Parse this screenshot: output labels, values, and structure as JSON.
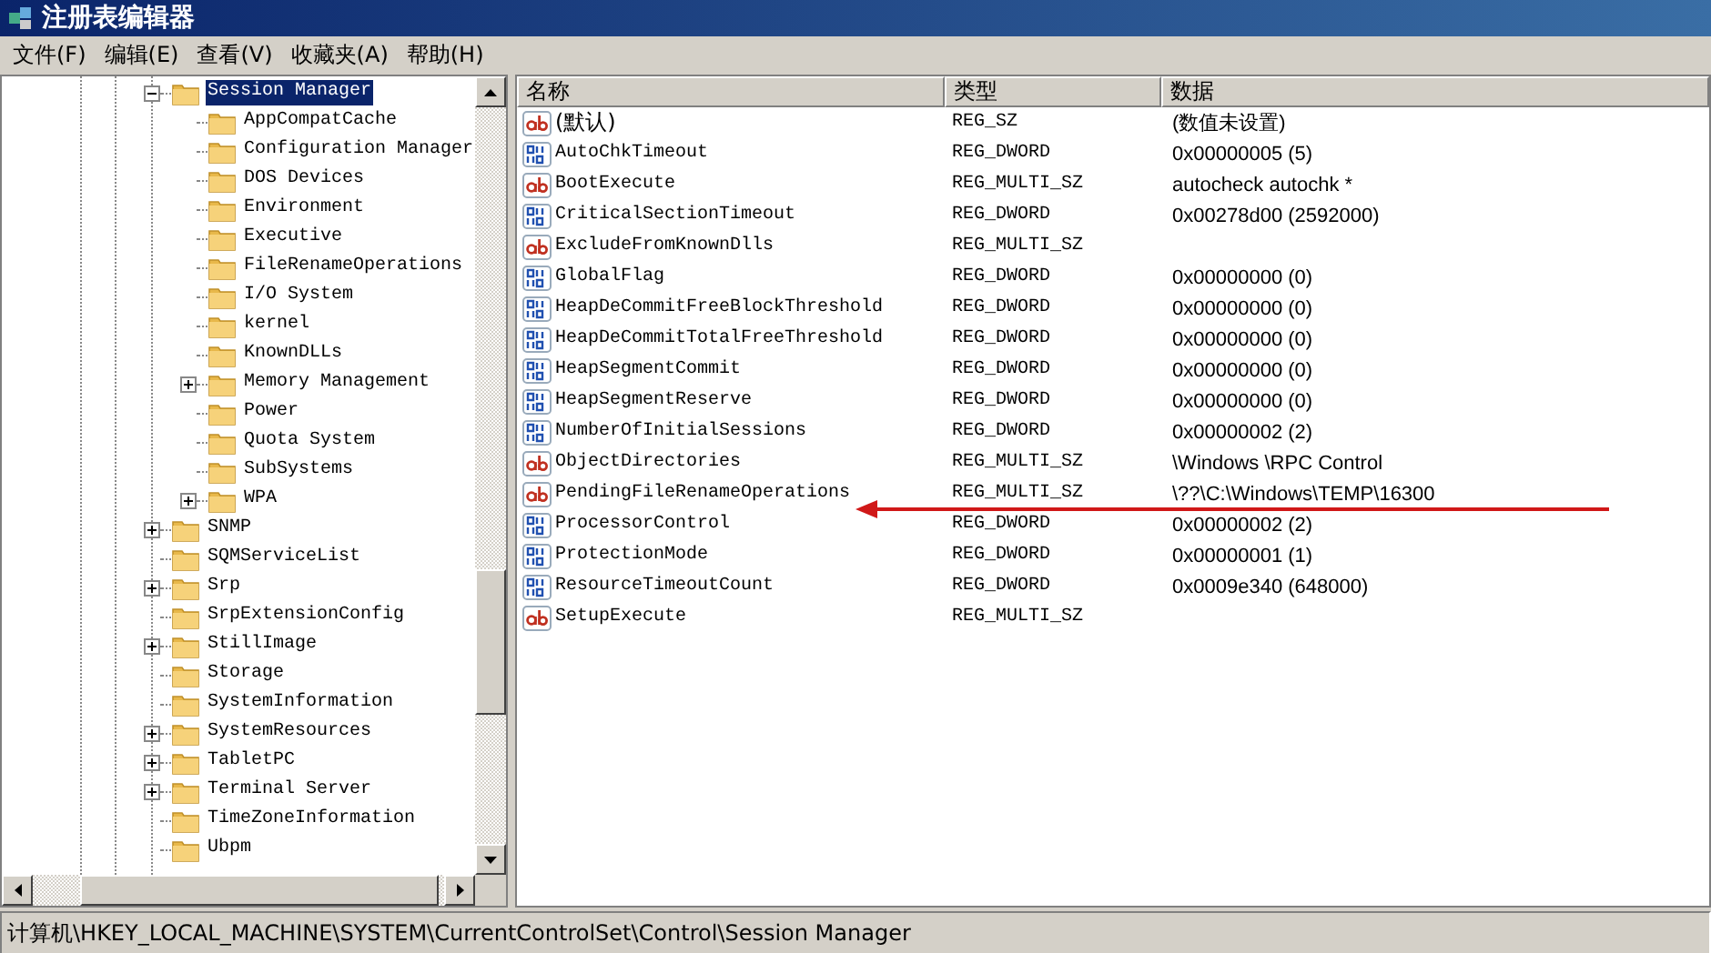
{
  "window": {
    "title": "注册表编辑器"
  },
  "menu": [
    "文件(F)",
    "编辑(E)",
    "查看(V)",
    "收藏夹(A)",
    "帮助(H)"
  ],
  "tree": {
    "items": [
      {
        "label": "Session Manager",
        "expanded": true,
        "selected": true,
        "children": [
          {
            "label": "AppCompatCache",
            "selected": false
          },
          {
            "label": "Configuration Manager",
            "selected": false
          },
          {
            "label": "DOS Devices",
            "selected": false
          },
          {
            "label": "Environment",
            "selected": false
          },
          {
            "label": "Executive",
            "selected": false
          },
          {
            "label": "FileRenameOperations",
            "selected": false
          },
          {
            "label": "I/O System",
            "selected": false
          },
          {
            "label": "kernel",
            "selected": false
          },
          {
            "label": "KnownDLLs",
            "selected": false
          },
          {
            "label": "Memory Management",
            "expanded": false,
            "selected": false
          },
          {
            "label": "Power",
            "selected": false
          },
          {
            "label": "Quota System",
            "selected": false
          },
          {
            "label": "SubSystems",
            "selected": false
          },
          {
            "label": "WPA",
            "expanded": false,
            "selected": false
          }
        ]
      },
      {
        "label": "SNMP",
        "expanded": false,
        "selected": false
      },
      {
        "label": "SQMServiceList",
        "selected": false
      },
      {
        "label": "Srp",
        "expanded": false,
        "selected": false
      },
      {
        "label": "SrpExtensionConfig",
        "selected": false
      },
      {
        "label": "StillImage",
        "expanded": false,
        "selected": false
      },
      {
        "label": "Storage",
        "selected": false
      },
      {
        "label": "SystemInformation",
        "selected": false
      },
      {
        "label": "SystemResources",
        "expanded": false,
        "selected": false
      },
      {
        "label": "TabletPC",
        "expanded": false,
        "selected": false
      },
      {
        "label": "Terminal Server",
        "expanded": false,
        "selected": false
      },
      {
        "label": "TimeZoneInformation",
        "selected": false
      },
      {
        "label": "Ubpm",
        "selected": false
      }
    ]
  },
  "table": {
    "columns": [
      "名称",
      "类型",
      "数据"
    ],
    "rows": [
      {
        "kind": "string",
        "name": "(默认)",
        "type": "REG_SZ",
        "data": "(数值未设置)"
      },
      {
        "kind": "binary",
        "name": "AutoChkTimeout",
        "type": "REG_DWORD",
        "data": "0x00000005 (5)"
      },
      {
        "kind": "string",
        "name": "BootExecute",
        "type": "REG_MULTI_SZ",
        "data": "autocheck autochk *"
      },
      {
        "kind": "binary",
        "name": "CriticalSectionTimeout",
        "type": "REG_DWORD",
        "data": "0x00278d00 (2592000)"
      },
      {
        "kind": "string",
        "name": "ExcludeFromKnownDlls",
        "type": "REG_MULTI_SZ"
      },
      {
        "kind": "binary",
        "name": "GlobalFlag",
        "type": "REG_DWORD",
        "data": "0x00000000 (0)"
      },
      {
        "kind": "binary",
        "name": "HeapDeCommitFreeBlockThreshold",
        "type": "REG_DWORD",
        "data": "0x00000000 (0)"
      },
      {
        "kind": "binary",
        "name": "HeapDeCommitTotalFreeThreshold",
        "type": "REG_DWORD",
        "data": "0x00000000 (0)"
      },
      {
        "kind": "binary",
        "name": "HeapSegmentCommit",
        "type": "REG_DWORD",
        "data": "0x00000000 (0)"
      },
      {
        "kind": "binary",
        "name": "HeapSegmentReserve",
        "type": "REG_DWORD",
        "data": "0x00000000 (0)"
      },
      {
        "kind": "binary",
        "name": "NumberOfInitialSessions",
        "type": "REG_DWORD",
        "data": "0x00000002 (2)"
      },
      {
        "kind": "string",
        "name": "ObjectDirectories",
        "type": "REG_MULTI_SZ",
        "data": "\\Windows \\RPC Control"
      },
      {
        "kind": "string",
        "name": "PendingFileRenameOperations",
        "type": "REG_MULTI_SZ",
        "data": "\\??\\C:\\Windows\\TEMP\\16300"
      },
      {
        "kind": "binary",
        "name": "ProcessorControl",
        "type": "REG_DWORD",
        "data": "0x00000002 (2)"
      },
      {
        "kind": "binary",
        "name": "ProtectionMode",
        "type": "REG_DWORD",
        "data": "0x00000001 (1)"
      },
      {
        "kind": "binary",
        "name": "ResourceTimeoutCount",
        "type": "REG_DWORD",
        "data": "0x0009e340 (648000)"
      },
      {
        "kind": "string",
        "name": "SetupExecute",
        "type": "REG_MULTI_SZ"
      }
    ]
  },
  "status_bar": "计算机\\HKEY_LOCAL_MACHINE\\SYSTEM\\CurrentControlSet\\Control\\Session Manager"
}
